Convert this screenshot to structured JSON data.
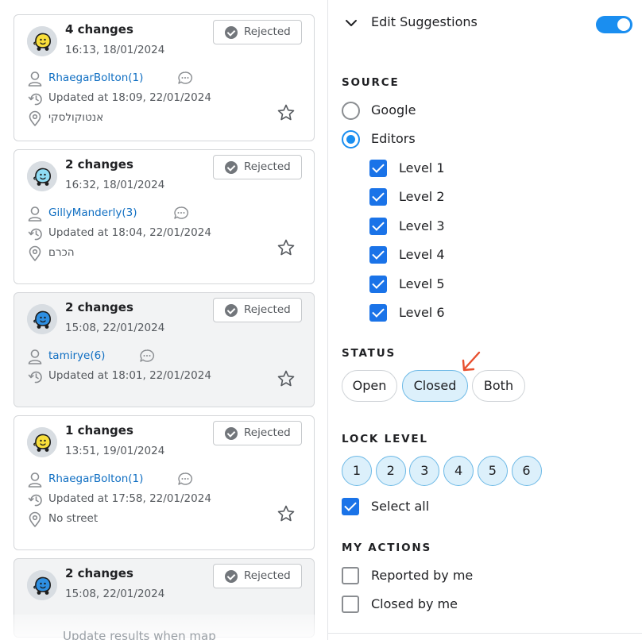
{
  "cards": [
    {
      "title": "4 changes",
      "time": "16:13, 18/01/2024",
      "status": "Rejected",
      "user": "RhaegarBolton(1)",
      "updated": "Updated at 18:09, 22/01/2024",
      "location": "אנטוקולסקי",
      "avatar_color": "#f8de3b",
      "gray": false
    },
    {
      "title": "2 changes",
      "time": "16:32, 18/01/2024",
      "status": "Rejected",
      "user": "GillyManderly(3)",
      "updated": "Updated at 18:04, 22/01/2024",
      "location": "הכרם",
      "avatar_color": "#8fdcf4",
      "gray": false
    },
    {
      "title": "2 changes",
      "time": "15:08, 22/01/2024",
      "status": "Rejected",
      "user": "tamirye(6)",
      "updated": "Updated at 18:01, 22/01/2024",
      "location": "",
      "avatar_color": "#2e8fe2",
      "gray": true
    },
    {
      "title": "1 changes",
      "time": "13:51, 19/01/2024",
      "status": "Rejected",
      "user": "RhaegarBolton(1)",
      "updated": "Updated at 17:58, 22/01/2024",
      "location": "No street",
      "avatar_color": "#f8de3b",
      "gray": false
    },
    {
      "title": "2 changes",
      "time": "15:08, 22/01/2024",
      "status": "Rejected",
      "user": "",
      "updated": "",
      "location": "",
      "avatar_color": "#2e8fe2",
      "gray": true
    }
  ],
  "footer_text": "Update results when map",
  "panel": {
    "title": "Edit Suggestions",
    "toggle_on": true,
    "source_title": "SOURCE",
    "source_options": [
      {
        "label": "Google",
        "selected": false
      },
      {
        "label": "Editors",
        "selected": true
      }
    ],
    "levels": [
      {
        "label": "Level 1",
        "checked": true
      },
      {
        "label": "Level 2",
        "checked": true
      },
      {
        "label": "Level 3",
        "checked": true
      },
      {
        "label": "Level 4",
        "checked": true
      },
      {
        "label": "Level 5",
        "checked": true
      },
      {
        "label": "Level 6",
        "checked": true
      }
    ],
    "status_title": "STATUS",
    "status_options": [
      {
        "label": "Open",
        "selected": false
      },
      {
        "label": "Closed",
        "selected": true
      },
      {
        "label": "Both",
        "selected": false
      }
    ],
    "lock_title": "LOCK LEVEL",
    "lock_levels": [
      "1",
      "2",
      "3",
      "4",
      "5",
      "6"
    ],
    "select_all_label": "Select all",
    "select_all_checked": true,
    "actions_title": "MY ACTIONS",
    "actions": [
      {
        "label": "Reported by me",
        "checked": false
      },
      {
        "label": "Closed by me",
        "checked": false
      }
    ]
  },
  "colors": {
    "accent": "#1a8ef0",
    "link": "#0f6ec2",
    "annotation_arrow": "#e8502f"
  }
}
